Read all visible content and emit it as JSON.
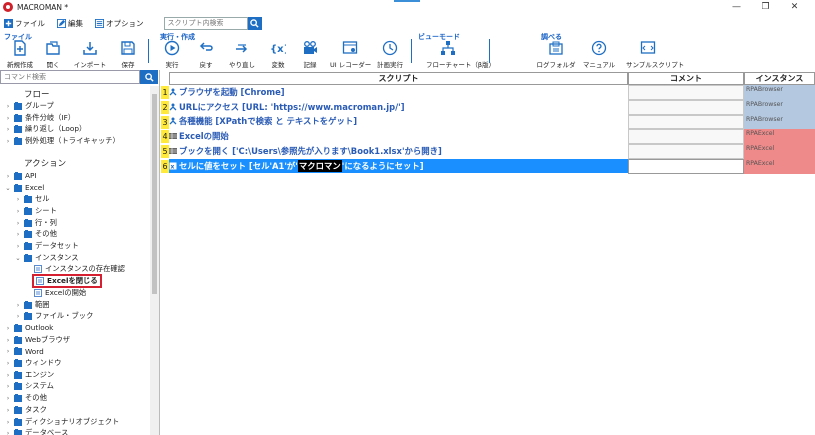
{
  "window": {
    "title": "MACROMAN *",
    "minimize": "—",
    "maximize": "❐",
    "close": "✕"
  },
  "menu": {
    "file": "ファイル",
    "edit": "編集",
    "options": "オプション",
    "search_placeholder": "スクリプト内検索"
  },
  "ribbon": {
    "groups": {
      "file": "ファイル",
      "run_create": "実行・作成",
      "view_mode": "ビューモード",
      "investigate": "調べる"
    },
    "tools": {
      "new": "新規作成",
      "open": "開く",
      "import": "インポート",
      "save": "保存",
      "run": "実行",
      "undo": "戻す",
      "redo": "やり直し",
      "variables": "変数",
      "record": "記録",
      "ui_recorder": "UI レコーダー",
      "schedule": "計画実行",
      "flowchart": "フローチャート（β版）",
      "log_folder": "ログフォルダ",
      "manual": "マニュアル",
      "sample_script": "サンプルスクリプト"
    }
  },
  "command_search_placeholder": "コマンド検索",
  "tree": {
    "flow_heading": "フロー",
    "flow_items": [
      "グループ",
      "条件分岐（IF）",
      "繰り返し（Loop）",
      "例外処理（トライキャッチ）"
    ],
    "action_heading": "アクション",
    "api": "API",
    "excel": "Excel",
    "excel_children": [
      "セル",
      "シート",
      "行・列",
      "その他",
      "データセット"
    ],
    "instance": "インスタンス",
    "instance_children": [
      "インスタンスの存在確認",
      "Excelを閉じる",
      "Excelの開始"
    ],
    "excel_tail": [
      "範囲",
      "ファイル・ブック"
    ],
    "others": [
      "Outlook",
      "Webブラウザ",
      "Word",
      "ウィンドウ",
      "エンジン",
      "システム",
      "その他",
      "タスク",
      "ディクショナリオブジェクト",
      "データベース"
    ]
  },
  "grid": {
    "headers": {
      "script": "スクリプト",
      "comment": "コメント",
      "instance": "インスタンス"
    },
    "rows": [
      {
        "num": "1",
        "text": "ブラウザを起動 [Chrome]",
        "instance": "RPABrowser",
        "type": "browser"
      },
      {
        "num": "2",
        "text": "URLにアクセス [URL: 'https://www.macroman.jp/']",
        "instance": "RPABrowser",
        "type": "browser"
      },
      {
        "num": "3",
        "text": "各種機能 [XPathで検索 と テキストをゲット]",
        "instance": "RPABrowser",
        "type": "browser"
      },
      {
        "num": "4",
        "text": "Excelの開始",
        "instance": "RPAExcel",
        "type": "excel"
      },
      {
        "num": "5",
        "text": "ブックを開く ['C:\\Users\\参照先が入ります\\Book1.xlsx'から開き]",
        "instance": "RPAExcel",
        "type": "excel"
      },
      {
        "num": "6",
        "text_pre": "セルに値をセット [セル'A1'が'",
        "text_hl": "マクロマン",
        "text_post": "'になるようにセット]",
        "instance": "RPAExcel",
        "type": "excel"
      }
    ]
  },
  "colors": {
    "accent": "#1e6fc4",
    "selected_row": "#1a8fff",
    "browser_instance": "#b4c8e0",
    "excel_instance": "#ee8a8a",
    "line_number": "#ffe93a",
    "selected_outline": "#d42030"
  }
}
